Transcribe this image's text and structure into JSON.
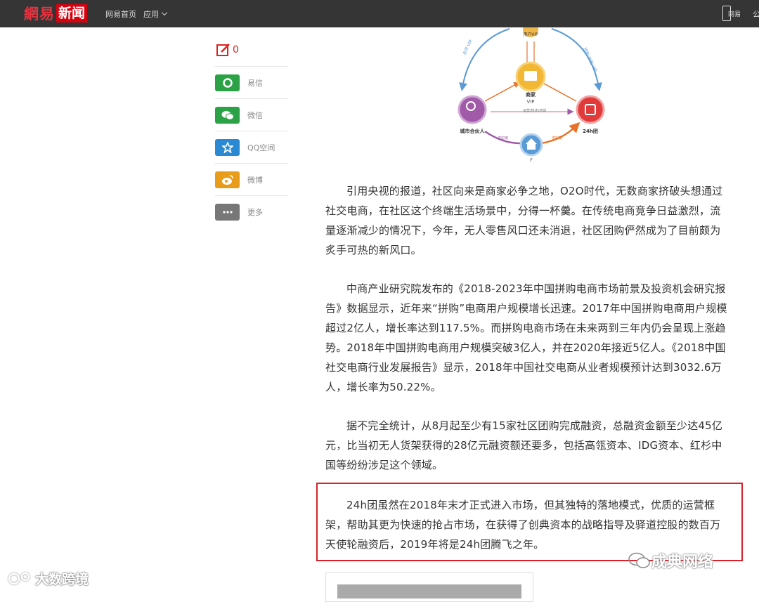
{
  "header": {
    "logo_brand": "網易",
    "logo_news": "新闻",
    "nav_home": "网易首页",
    "nav_app": "应用",
    "phone_label": "网易",
    "edge_text": "公"
  },
  "share": {
    "comment_count": "0",
    "items": [
      {
        "label": "易信",
        "icon": "yixin-icon",
        "color": "#2ba245",
        "glyph": "◯"
      },
      {
        "label": "微信",
        "icon": "wechat-icon",
        "color": "#2ba245",
        "glyph": "●"
      },
      {
        "label": "QQ空间",
        "icon": "qzone-star-icon",
        "color": "#2a89d3",
        "glyph": "☆"
      },
      {
        "label": "微博",
        "icon": "weibo-icon",
        "color": "#e89c1a",
        "glyph": "◉"
      },
      {
        "label": "更多",
        "icon": "more-icon",
        "color": "#777777",
        "glyph": "···"
      }
    ]
  },
  "diagram": {
    "top": "用户VIP",
    "center_title": "商家",
    "center_sub": "VIP",
    "left": "城市合伙人",
    "right": "24h团",
    "bottom": "F",
    "left_arc": "点评 VIP",
    "right_arc": "团购·补贴 VIP",
    "mid_line": "运营/技术/培训",
    "bottom_left": "供应链",
    "bottom_right": "供应链"
  },
  "article": {
    "p1": "引用央视的报道，社区向来是商家必争之地，O2O时代，无数商家挤破头想通过社交电商，在社区这个终端生活场景中，分得一杯羹。在传统电商竞争日益激烈，流量逐渐减少的情况下，今年，无人零售风口还未消退，社区团购俨然成为了目前颇为炙手可热的新风口。",
    "p2": "中商产业研究院发布的《2018-2023年中国拼购电商市场前景及投资机会研究报告》数据显示，近年来“拼购”电商用户规模增长迅速。2017年中国拼购电商用户规模超过2亿人，增长率达到117.5%。而拼购电商市场在未来两到三年内仍会呈现上涨趋势。2018年中国拼购电商用户规模突破3亿人，并在2020年接近5亿人。《2018中国社交电商行业发展报告》显示，2018年中国社交电商从业者规模预计达到3032.6万人，增长率为50.22%。",
    "p3": "据不完全统计，从8月起至少有15家社区团购完成融资，总融资金额至少达45亿元，比当初无人货架获得的28亿元融资额还要多，包括高瓴资本、IDG资本、红杉中国等纷纷涉足这个领域。",
    "p4": "24h团虽然在2018年末才正式进入市场，但其独特的落地模式，优质的运营框架，帮助其更为快速的抢占市场，在获得了创典资本的战略指导及驿道控股的数百万天使轮融资后，2019年将是24h团腾飞之年。"
  },
  "watermark": {
    "left": "大数跨境",
    "right": "成典网络"
  },
  "colors": {
    "topbar": "#353535",
    "brand_red": "#d7000f",
    "highlight": "#d9222a"
  }
}
